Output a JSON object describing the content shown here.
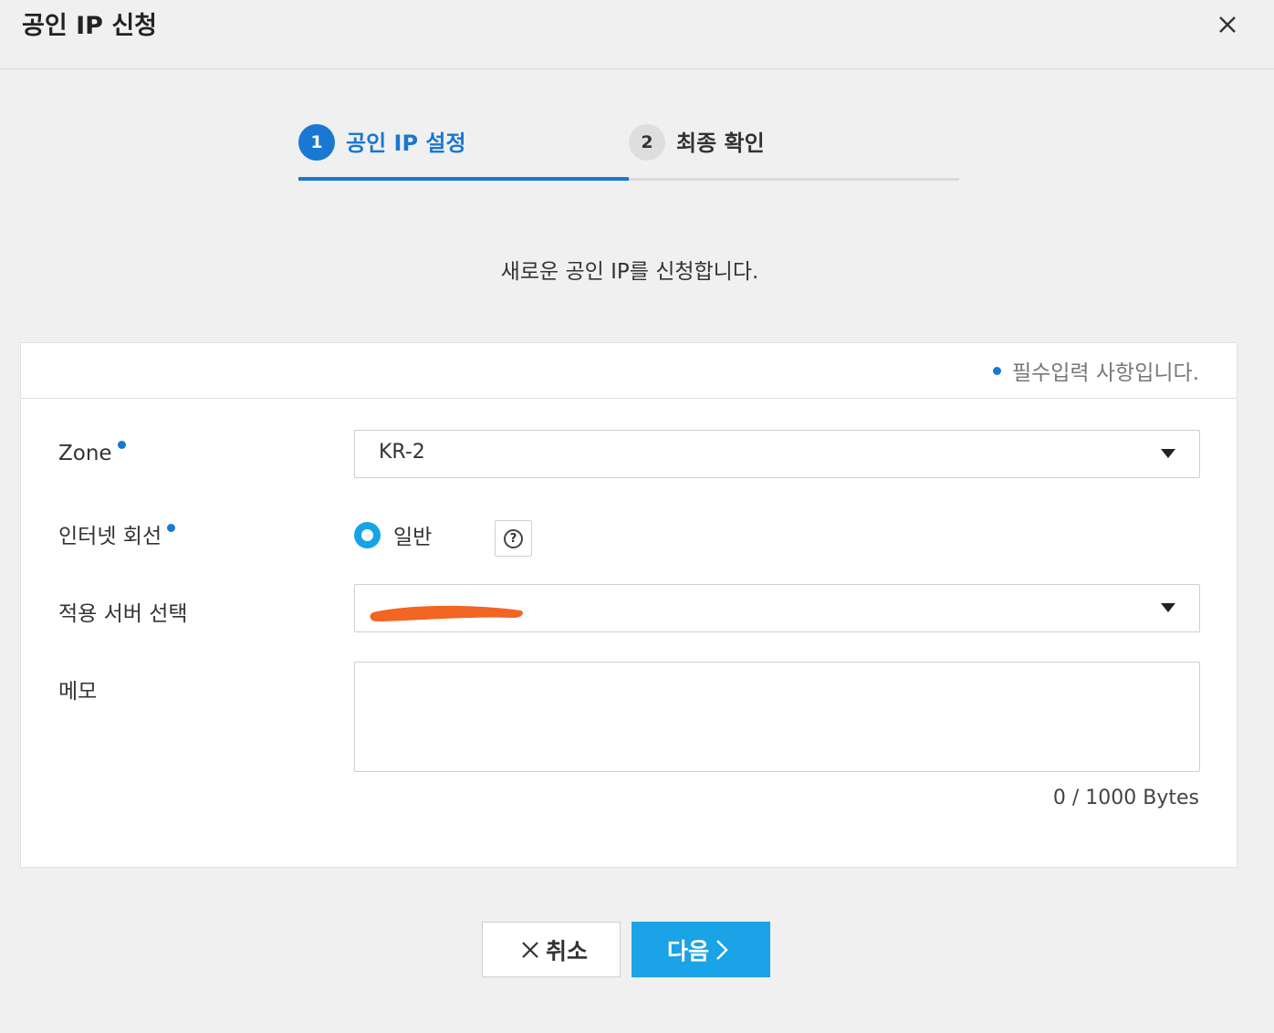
{
  "dialog": {
    "title": "공인 IP 신청",
    "close_icon": "close-icon"
  },
  "stepper": {
    "steps": [
      {
        "number": "1",
        "label": "공인 IP 설정",
        "active": true
      },
      {
        "number": "2",
        "label": "최종 확인",
        "active": false
      }
    ]
  },
  "intro_text": "새로운 공인 IP를 신청합니다.",
  "form": {
    "required_note": "필수입력 사항입니다.",
    "zone": {
      "label": "Zone",
      "value": "KR-2",
      "required": true
    },
    "internet_line": {
      "label": "인터넷 회선",
      "required": true,
      "options": [
        {
          "label": "일반",
          "selected": true
        }
      ],
      "help_icon": "question-circle-icon"
    },
    "target_server": {
      "label": "적용 서버 선택",
      "value": "",
      "redacted": true
    },
    "memo": {
      "label": "메모",
      "value": "",
      "counter": "0 / 1000 Bytes"
    }
  },
  "actions": {
    "cancel_label": "취소",
    "next_label": "다음"
  },
  "colors": {
    "accent": "#1878d2",
    "button_primary": "#1aa3e6",
    "radio": "#16a3e8",
    "redaction": "#f26522"
  }
}
